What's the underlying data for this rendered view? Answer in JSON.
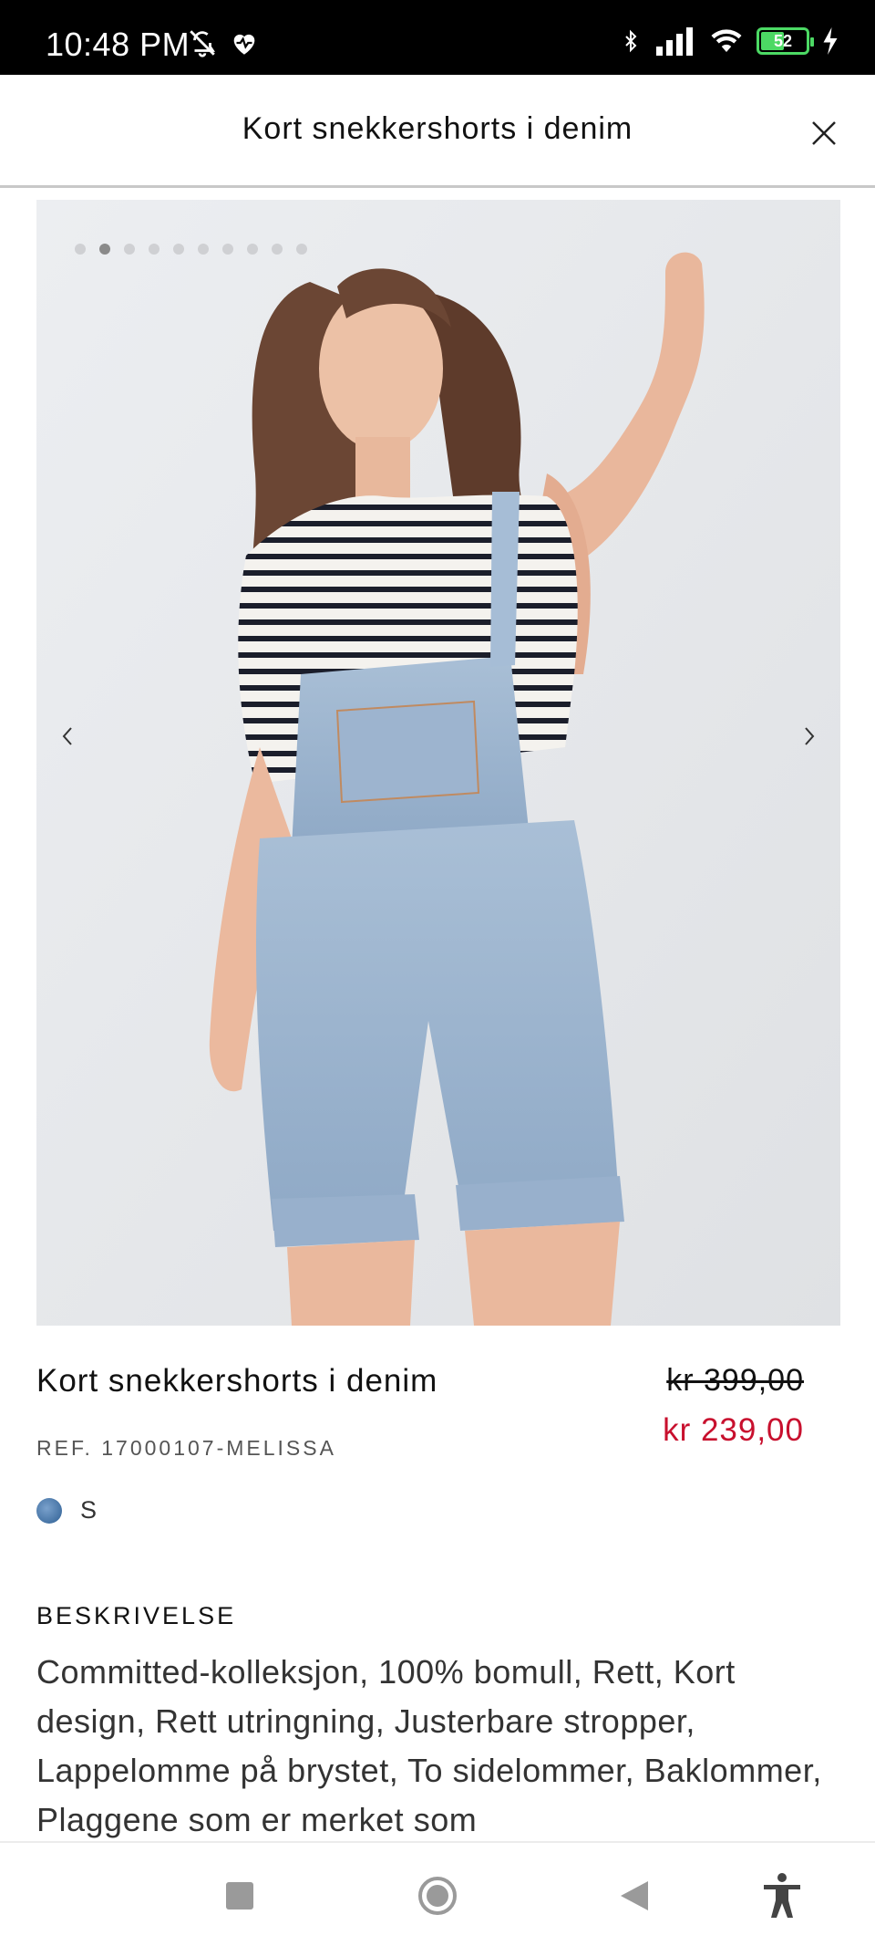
{
  "status_bar": {
    "time": "10:48 PM",
    "battery_level": "52",
    "battery_fraction": 0.52,
    "icons": [
      "mute-bell-icon",
      "heart-pulse-icon",
      "bluetooth-icon",
      "signal-icon",
      "wifi-icon",
      "battery-icon",
      "charging-icon"
    ]
  },
  "header": {
    "title": "Kort snekkershorts i denim",
    "close_icon": "close-icon"
  },
  "gallery": {
    "image_alt": "Model wearing light-wash denim short overalls over a striped top",
    "dot_count": 10,
    "active_index": 1,
    "prev_icon": "chevron-left-icon",
    "next_icon": "chevron-right-icon"
  },
  "product": {
    "name": "Kort snekkershorts i denim",
    "price_old": "kr 399,00",
    "price_new": "kr 239,00",
    "ref": "REF. 17000107-MELISSA",
    "size": "S",
    "price_color": "#c8102e"
  },
  "description": {
    "heading": "BESKRIVELSE",
    "text": "Committed-kolleksjon, 100% bomull, Rett, Kort design, Rett utringning, Justerbare stropper, Lappelomme på brystet, To sidelommer, Baklommer, Plaggene som er merket som"
  },
  "navbar": {
    "buttons": [
      "recents-square-icon",
      "home-circle-icon",
      "back-triangle-icon",
      "accessibility-icon"
    ]
  }
}
